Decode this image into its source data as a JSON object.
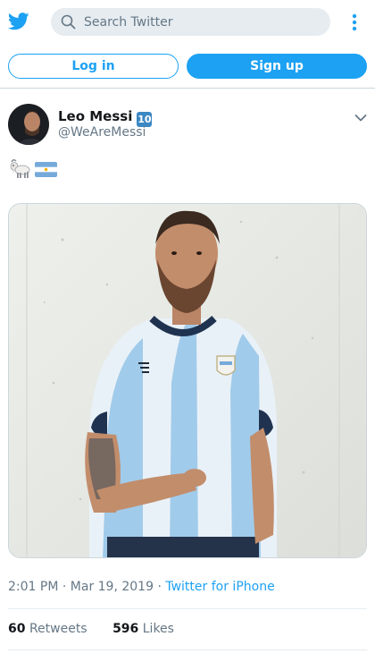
{
  "header": {
    "logo_icon": "twitter-bird-icon",
    "search": {
      "placeholder": "Search Twitter",
      "value": ""
    },
    "menu_icon": "vertical-ellipsis-icon",
    "accent": "#1da1f2"
  },
  "auth": {
    "login_label": "Log in",
    "signup_label": "Sign up"
  },
  "tweet": {
    "author": {
      "name": "Leo Messi",
      "badge": "10",
      "handle": "@WeAreMessi"
    },
    "text_icons": [
      "goat-emoji",
      "argentina-flag-emoji"
    ],
    "media": {
      "subject": "photo-of-man-in-argentina-jersey"
    },
    "time": "2:01 PM",
    "date": "Mar 19, 2019",
    "source": "Twitter for iPhone",
    "retweets": {
      "count": "60",
      "label": "Retweets"
    },
    "likes": {
      "count": "596",
      "label": "Likes"
    }
  }
}
